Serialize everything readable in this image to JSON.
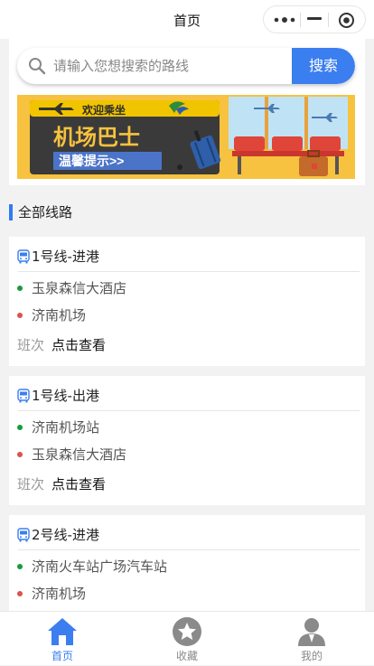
{
  "navbar": {
    "title": "首页"
  },
  "search": {
    "placeholder": "请输入您想搜索的路线",
    "button_label": "搜索"
  },
  "banner": {
    "welcome": "欢迎乘坐",
    "title": "机场巴士",
    "tip": "温馨提示>>"
  },
  "section": {
    "title": "全部线路"
  },
  "routes": [
    {
      "name": "1号线-进港",
      "from": "玉泉森信大酒店",
      "to": "济南机场",
      "schedule_label": "班次",
      "schedule_link": "点击查看"
    },
    {
      "name": "1号线-出港",
      "from": "济南机场站",
      "to": "玉泉森信大酒店",
      "schedule_label": "班次",
      "schedule_link": "点击查看"
    },
    {
      "name": "2号线-进港",
      "from": "济南火车站广场汽车站",
      "to": "济南机场"
    }
  ],
  "tabs": [
    {
      "label": "首页",
      "icon": "home-icon",
      "active": true
    },
    {
      "label": "收藏",
      "icon": "star-icon",
      "active": false
    },
    {
      "label": "我的",
      "icon": "user-icon",
      "active": false
    }
  ],
  "colors": {
    "accent": "#3b7ef0",
    "start_dot": "#1a9a3a",
    "end_dot": "#d9534f",
    "inactive_tab": "#8a8a8a"
  }
}
